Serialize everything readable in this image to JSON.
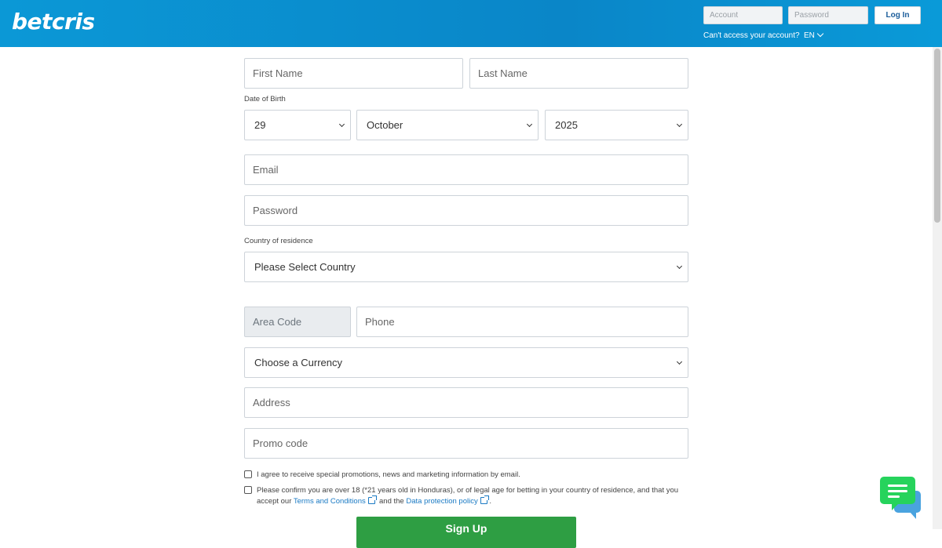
{
  "header": {
    "logo": "betcris",
    "account_placeholder": "Account",
    "password_placeholder": "Password",
    "login_label": "Log In",
    "cant_access": "Can't access your account?",
    "language": "EN"
  },
  "form": {
    "first_name_placeholder": "First Name",
    "last_name_placeholder": "Last Name",
    "dob_label": "Date of Birth",
    "dob_day": "29",
    "dob_month": "October",
    "dob_year": "2025",
    "email_placeholder": "Email",
    "password_placeholder": "Password",
    "country_label": "Country of residence",
    "country_select": "Please Select Country",
    "area_code_placeholder": "Area Code",
    "phone_placeholder": "Phone",
    "currency_select": "Choose a Currency",
    "address_placeholder": "Address",
    "promo_placeholder": "Promo code",
    "promotions_consent": "I agree to receive special promotions, news and marketing information by email.",
    "age_consent_line1": "Please confirm you are over 18 (*21 years old in Honduras), or of legal age for betting in your country of residence, and that you",
    "age_consent_accept": "accept our",
    "terms_link": "Terms and Conditions",
    "and_the": "and the",
    "privacy_link": "Data protection policy",
    "period": ".",
    "submit_label": "Sign Up"
  },
  "colors": {
    "header_blue": "#0a86c8",
    "submit_green": "#2e9e43",
    "chat_green": "#26d35c",
    "link_blue": "#1a7ac4"
  },
  "icons": {
    "language_chevron": "chevron-down-icon",
    "select_caret": "chevron-down-icon",
    "external_link": "external-link-icon",
    "chat": "chat-bubbles-icon"
  }
}
